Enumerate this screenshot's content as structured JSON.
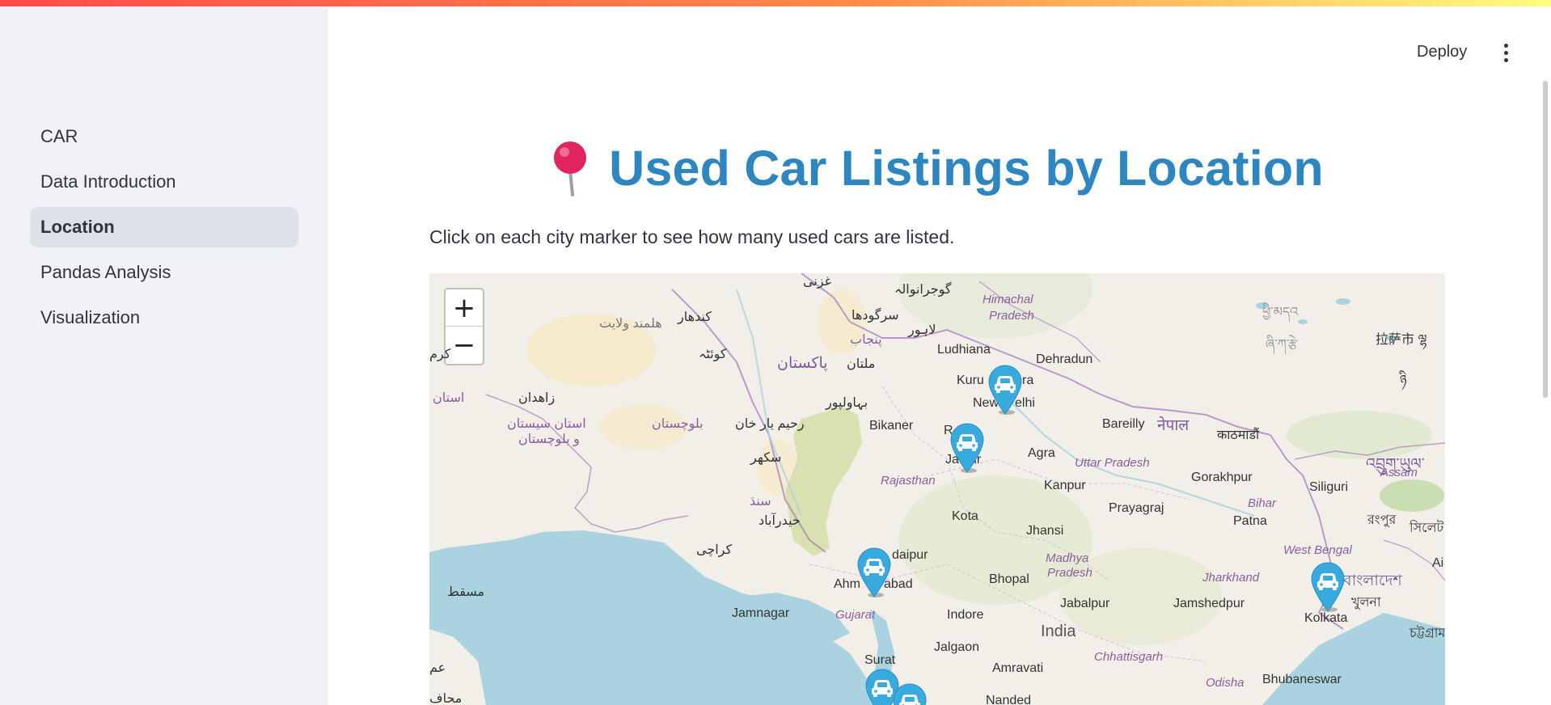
{
  "sidebar": {
    "items": [
      {
        "label": "CAR",
        "active": false
      },
      {
        "label": "Data Introduction",
        "active": false
      },
      {
        "label": "Location",
        "active": true
      },
      {
        "label": "Pandas Analysis",
        "active": false
      },
      {
        "label": "Visualization",
        "active": false
      }
    ]
  },
  "header": {
    "deploy_label": "Deploy",
    "menu_icon": "more-vertical-icon"
  },
  "page": {
    "title_icon": "round-pushpin-icon",
    "title": "Used Car Listings by Location",
    "subtitle": "Click on each city marker to see how many used cars are listed.",
    "title_color": "#2e86c1"
  },
  "map": {
    "zoom_in": "+",
    "zoom_out": "−",
    "marker_color": "#38aadd",
    "marker_icon": "car-icon",
    "markers": [
      {
        "city": "New Delhi"
      },
      {
        "city": "Jaipur"
      },
      {
        "city": "Ahmedabad"
      },
      {
        "city": "Kolkata"
      },
      {
        "city": "Surat"
      },
      {
        "city": "Mumbai"
      }
    ],
    "labels": {
      "kandahar": "کندهار",
      "helmand": "هلمند ولایت",
      "quetta": "کوئٹہ",
      "pakistan": "پاکستان",
      "multan": "ملتان",
      "bahawalpur": "بہاولپور",
      "rahim": "رحیم یار خان",
      "sukkur": "سکھر",
      "sindh": "سنڌ",
      "hyderabad": "حیدرآباد",
      "karachi": "کراچی",
      "balochistan": "بلوچستان",
      "sistan": "استان سیستان",
      "sistan2": "و بلوچستان",
      "zahedan": "زاهدان",
      "ostan": "استان",
      "kerman": "کرم",
      "muscat": "مسقط",
      "gujranwala": "گوجرانوالہ",
      "sargodha": "سرگودھا",
      "punjab": "پنجاب",
      "lahore": "لاہور",
      "ghazni": "غزنی",
      "himachal": "Himachal",
      "himachal2": "Pradesh",
      "ludhiana": "Ludhiana",
      "dehradun": "Dehradun",
      "kurukshetra": "Kuru",
      "kurukshetra2": "ra",
      "newdelhi": "New",
      "newdelhi2": "elhi",
      "bikaner": "Bikaner",
      "rohtak": "R",
      "jaipur": "Ja",
      "jaipur2": "ur",
      "agra": "Agra",
      "bareilly": "Bareilly",
      "rajasthan": "Rajasthan",
      "uttar": "Uttar Pradesh",
      "kanpur": "Kanpur",
      "nepal": "नेपाल",
      "kathmandu": "काठमाडौं",
      "gorakhpur": "Gorakhpur",
      "kota": "Kota",
      "jhansi": "Jhansi",
      "prayagraj": "Prayagraj",
      "patna": "Patna",
      "bihar": "Bihar",
      "siliguri": "Siliguri",
      "assam": "Assam",
      "rangpur": "রংপুর",
      "sylhet": "সিলেট",
      "bhutan": "འབྲུག་ཡུལ་",
      "tibet": "拉萨市 ལྷ",
      "tibet2": "ཉི",
      "tibet3": "ཞི་ཀ་རྩེ",
      "tibet4": "ཕྱི་མདའ",
      "udaipur": "daipur",
      "ahmedabad": "Ahm",
      "ahmedabad2": "abad",
      "bhopal": "Bhopal",
      "madhya": "Madhya",
      "madhya2": "Pradesh",
      "jharkhand": "Jharkhand",
      "westbengal": "West Bengal",
      "bangladesh": "বাংলাদেশ",
      "khulna": "খুলনা",
      "jabalpur": "Jabalpur",
      "jamshedpur": "Jamshedpur",
      "jamnagar": "Jamnagar",
      "gujarat": "Gujarat",
      "indore": "Indore",
      "india": "India",
      "kolkata": "Kolkata",
      "chittagong": "চট্টগ্রাম",
      "jalgaon": "Jalgaon",
      "chhattisgarh": "Chhattisgarh",
      "surat": "Surat",
      "amravati": "Amravati",
      "odisha": "Odisha",
      "bhubaneswar": "Bhubaneswar",
      "nanded": "Nanded",
      "ai": "Ai",
      "mahafa": "محاف",
      "om": "عم"
    }
  }
}
